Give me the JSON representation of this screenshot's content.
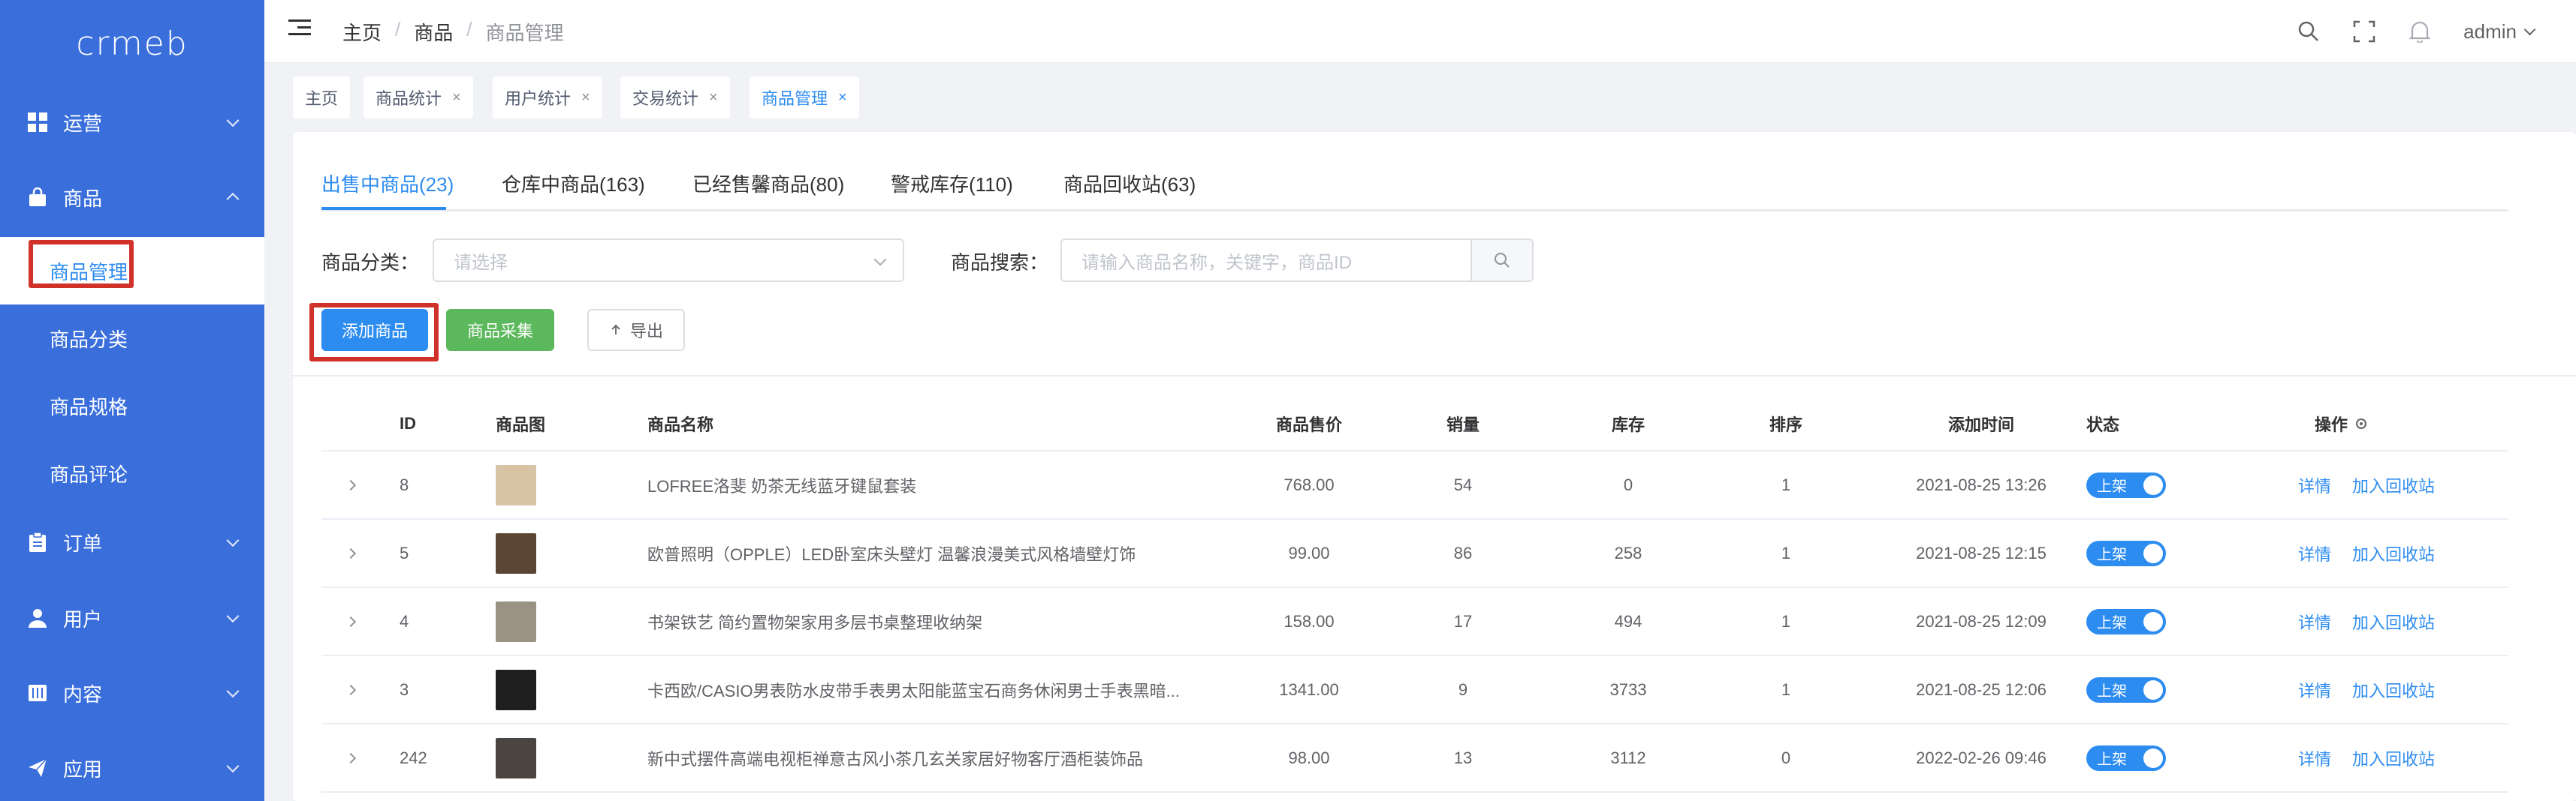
{
  "app": {
    "logo_text": "crmeb"
  },
  "sidebar": {
    "items": [
      {
        "label": "运营",
        "icon": "dashboard-icon"
      },
      {
        "label": "商品",
        "icon": "bag-icon"
      },
      {
        "label": "订单",
        "icon": "clipboard-icon"
      },
      {
        "label": "用户",
        "icon": "user-icon"
      },
      {
        "label": "内容",
        "icon": "book-icon"
      },
      {
        "label": "应用",
        "icon": "send-icon"
      }
    ],
    "submenu": [
      {
        "label": "商品管理",
        "active": true
      },
      {
        "label": "商品分类"
      },
      {
        "label": "商品规格"
      },
      {
        "label": "商品评论"
      }
    ]
  },
  "header": {
    "breadcrumb": [
      "主页",
      "商品",
      "商品管理"
    ],
    "user": "admin"
  },
  "tags": [
    "主页",
    "商品统计",
    "用户统计",
    "交易统计",
    "商品管理"
  ],
  "tabs": [
    "出售中商品(23)",
    "仓库中商品(163)",
    "已经售馨商品(80)",
    "警戒库存(110)",
    "商品回收站(63)"
  ],
  "filters": {
    "category_label": "商品分类：",
    "category_placeholder": "请选择",
    "search_label": "商品搜索：",
    "search_placeholder": "请输入商品名称，关键字，商品ID"
  },
  "actions": {
    "add": "添加商品",
    "collect": "商品采集",
    "export": "导出"
  },
  "table": {
    "headers": {
      "id": "ID",
      "image": "商品图",
      "name": "商品名称",
      "price": "商品售价",
      "sales": "销量",
      "stock": "库存",
      "sort": "排序",
      "time": "添加时间",
      "status": "状态",
      "ops": "操作"
    },
    "rows": [
      {
        "id": "8",
        "name": "LOFREE洛斐 奶茶无线蓝牙键鼠套装",
        "price": "768.00",
        "sales": "54",
        "stock": "0",
        "sort": "1",
        "time": "2021-08-25 13:26",
        "status": "上架",
        "thumb": "#d9c3a5"
      },
      {
        "id": "5",
        "name": "欧普照明（OPPLE）LED卧室床头壁灯 温馨浪漫美式风格墙壁灯饰",
        "price": "99.00",
        "sales": "86",
        "stock": "258",
        "sort": "1",
        "time": "2021-08-25 12:15",
        "status": "上架",
        "thumb": "#5a4632"
      },
      {
        "id": "4",
        "name": "书架铁艺 简约置物架家用多层书桌整理收纳架",
        "price": "158.00",
        "sales": "17",
        "stock": "494",
        "sort": "1",
        "time": "2021-08-25 12:09",
        "status": "上架",
        "thumb": "#9a9384"
      },
      {
        "id": "3",
        "name": "卡西欧/CASIO男表防水皮带手表男太阳能蓝宝石商务休闲男士手表黑暗...",
        "price": "1341.00",
        "sales": "9",
        "stock": "3733",
        "sort": "1",
        "time": "2021-08-25 12:06",
        "status": "上架",
        "thumb": "#1f1f1f"
      },
      {
        "id": "242",
        "name": "新中式摆件高端电视柜禅意古风小茶几玄关家居好物客厅酒柜装饰品",
        "price": "98.00",
        "sales": "13",
        "stock": "3112",
        "sort": "0",
        "time": "2022-02-26 09:46",
        "status": "上架",
        "thumb": "#4a4540"
      }
    ],
    "op_detail": "详情",
    "op_recycle": "加入回收站"
  },
  "colors": {
    "sidebar": "#3a6fdb",
    "primary": "#2d8cf0",
    "success": "#5cb85c",
    "highlight": "#d0322a"
  }
}
